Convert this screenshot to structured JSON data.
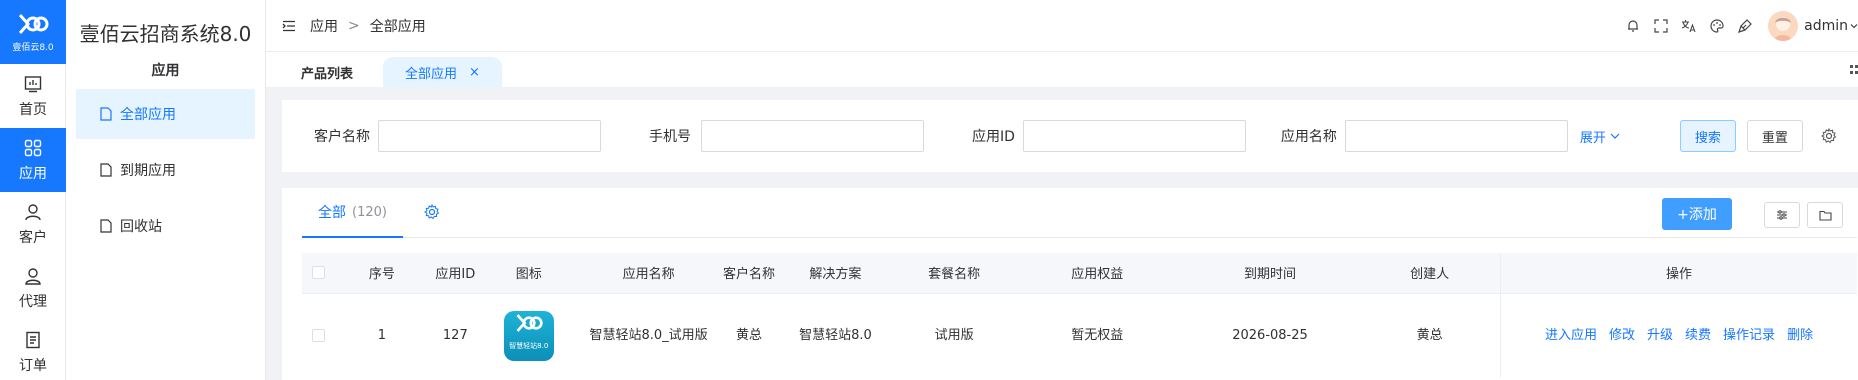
{
  "brand": {
    "short": "壹佰云8.0",
    "system_title": "壹佰云招商系统8.0",
    "accent": "#1677ff"
  },
  "rail": [
    {
      "label": "首页",
      "icon": "dashboard-icon",
      "active": false
    },
    {
      "label": "应用",
      "icon": "apps-grid-icon",
      "active": true
    },
    {
      "label": "客户",
      "icon": "user-icon",
      "active": false
    },
    {
      "label": "代理",
      "icon": "agent-icon",
      "active": false
    },
    {
      "label": "订单",
      "icon": "order-icon",
      "active": false
    }
  ],
  "submenu": {
    "heading": "应用",
    "items": [
      {
        "label": "全部应用",
        "active": true
      },
      {
        "label": "到期应用",
        "active": false
      },
      {
        "label": "回收站",
        "active": false
      }
    ]
  },
  "header": {
    "breadcrumb": [
      "应用",
      "全部应用"
    ],
    "breadcrumb_sep": ">",
    "icons": [
      "bell-icon",
      "fullscreen-icon",
      "translate-icon",
      "palette-icon",
      "clear-cache-icon"
    ],
    "username": "admin"
  },
  "page_tabs": [
    {
      "label": "产品列表",
      "active": false
    },
    {
      "label": "全部应用",
      "active": true,
      "close": "×"
    }
  ],
  "search": {
    "fields": [
      {
        "label": "客户名称",
        "value": ""
      },
      {
        "label": "手机号",
        "value": ""
      },
      {
        "label": "应用ID",
        "value": ""
      },
      {
        "label": "应用名称",
        "value": ""
      }
    ],
    "expand_label": "展开",
    "search_button": "搜索",
    "reset_button": "重置"
  },
  "list": {
    "tab_label": "全部",
    "tab_count": "(120)",
    "add_button": "+添加",
    "columns": [
      "序号",
      "应用ID",
      "图标",
      "应用名称",
      "客户名称",
      "解决方案",
      "套餐名称",
      "应用权益",
      "到期时间",
      "创建人",
      "操作"
    ],
    "rows": [
      {
        "index": "1",
        "app_id": "127",
        "icon_caption": "智慧轻站8.0",
        "app_name": "智慧轻站8.0_试用版",
        "customer": "黄总",
        "solution": "智慧轻站8.0",
        "package": "试用版",
        "rights": "暂无权益",
        "expire": "2026-08-25",
        "creator": "黄总",
        "actions": [
          "进入应用",
          "修改",
          "升级",
          "续费",
          "操作记录",
          "删除"
        ]
      }
    ]
  }
}
